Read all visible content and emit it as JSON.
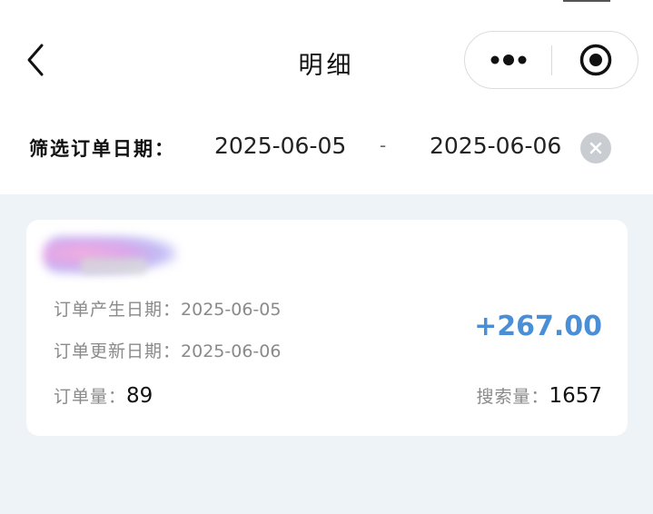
{
  "nav": {
    "title": "明细",
    "back_icon": "chevron-left-icon",
    "more_icon": "more-dots-icon",
    "close_icon": "target-circle-icon"
  },
  "filter": {
    "label": "筛选订单日期：",
    "start_date": "2025-06-05",
    "separator": "-",
    "end_date": "2025-06-06",
    "clear_icon": "clear-circle-icon"
  },
  "record": {
    "created_label": "订单产生日期：",
    "created_date": "2025-06-05",
    "updated_label": "订单更新日期：",
    "updated_date": "2025-06-06",
    "amount": "+267.00",
    "orders_label": "订单量：",
    "orders_value": "89",
    "search_label": "搜索量：",
    "search_value": "1657"
  },
  "colors": {
    "accent": "#4a8fd6",
    "background": "#eef3f8",
    "card": "#ffffff"
  }
}
